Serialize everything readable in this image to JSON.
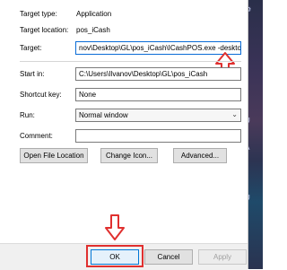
{
  "general": {
    "target_type_label": "Target type:",
    "target_type_value": "Application",
    "target_location_label": "Target location:",
    "target_location_value": "pos_iCash",
    "target_label": "Target:",
    "target_value": "nov\\Desktop\\GL\\pos_iCash\\ICashPOS.exe -desktop",
    "start_in_label": "Start in:",
    "start_in_value": "C:\\Users\\Ilvanov\\Desktop\\GL\\pos_iCash",
    "shortcut_key_label": "Shortcut key:",
    "shortcut_key_value": "None",
    "run_label": "Run:",
    "run_value": "Normal window",
    "comment_label": "Comment:",
    "comment_value": ""
  },
  "buttons": {
    "open_file_location": "Open File Location",
    "change_icon": "Change Icon...",
    "advanced": "Advanced..."
  },
  "footer": {
    "ok": "OK",
    "cancel": "Cancel",
    "apply": "Apply"
  },
  "annotations": {
    "highlight_color": "#e0302f"
  },
  "desktop_edge": {
    "top_glyph": "⚙",
    "edge_text_1": "U",
    "edge_text_2": "A",
    "edge_text_3": "U"
  }
}
